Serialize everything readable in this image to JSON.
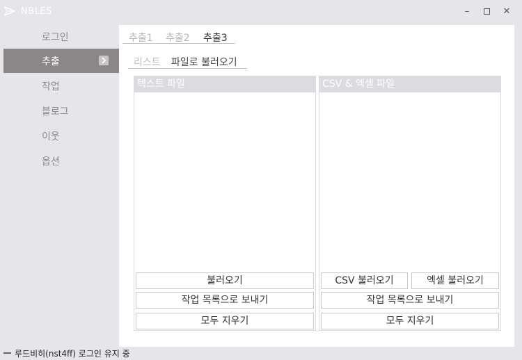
{
  "window": {
    "title": "NBLES",
    "minimize_glyph": "–",
    "close_glyph": "✕"
  },
  "sidebar": {
    "items": [
      {
        "label": "로그인",
        "active": false
      },
      {
        "label": "추출",
        "active": true
      },
      {
        "label": "작업",
        "active": false
      },
      {
        "label": "블로그",
        "active": false
      },
      {
        "label": "이웃",
        "active": false
      },
      {
        "label": "옵션",
        "active": false
      }
    ]
  },
  "tabs": [
    {
      "label": "추출1",
      "active": false
    },
    {
      "label": "추출2",
      "active": false
    },
    {
      "label": "추출3",
      "active": true
    }
  ],
  "subtabs": [
    {
      "label": "리스트",
      "active": false
    },
    {
      "label": "파일로 불러오기",
      "active": true
    }
  ],
  "text_section": {
    "header": "텍스트 파일",
    "load_button": "불러오기",
    "send_button": "작업 목록으로 보내기",
    "clear_button": "모두 지우기"
  },
  "csv_section": {
    "header": "CSV & 엑셀 파일",
    "csv_load_button": "CSV 불러오기",
    "excel_load_button": "엑셀 불러오기",
    "send_button": "작업 목록으로 보내기",
    "clear_button": "모두 지우기"
  },
  "status": {
    "text": "루드비히(nst4ff) 로그인 유지 중"
  },
  "colors": {
    "accent_sidebar": "#8b8687",
    "background": "#e6e5ea",
    "section_header": "#dcdbe0"
  }
}
